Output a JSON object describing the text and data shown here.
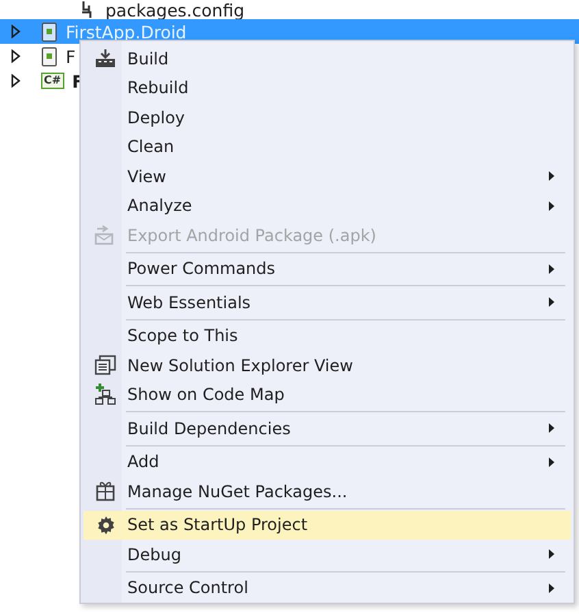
{
  "tree": [
    {
      "label": "packages.config",
      "kind": "file",
      "selected": false,
      "bold": false
    },
    {
      "label": "FirstApp.Droid",
      "kind": "android",
      "selected": true,
      "bold": false
    },
    {
      "label": "F",
      "kind": "ios",
      "selected": false,
      "bold": false
    },
    {
      "label": "F",
      "kind": "csharp",
      "selected": false,
      "bold": true,
      "badge": "C#"
    }
  ],
  "context_menu": [
    {
      "kind": "command",
      "label": "Build",
      "disabled": false,
      "selected": false
    },
    {
      "kind": "command",
      "label": "Rebuild",
      "disabled": false,
      "selected": false
    },
    {
      "kind": "command",
      "label": "Deploy",
      "disabled": false,
      "selected": false
    },
    {
      "kind": "command",
      "label": "Clean",
      "disabled": false,
      "selected": false
    },
    {
      "kind": "submenu",
      "label": "View",
      "disabled": false,
      "selected": false
    },
    {
      "kind": "submenu",
      "label": "Analyze",
      "disabled": false,
      "selected": false
    },
    {
      "kind": "command",
      "label": "Export Android Package (.apk)",
      "disabled": true,
      "selected": false
    },
    {
      "kind": "separator"
    },
    {
      "kind": "submenu",
      "label": "Power Commands",
      "disabled": false,
      "selected": false
    },
    {
      "kind": "separator"
    },
    {
      "kind": "submenu",
      "label": "Web Essentials",
      "disabled": false,
      "selected": false
    },
    {
      "kind": "separator"
    },
    {
      "kind": "command",
      "label": "Scope to This",
      "disabled": false,
      "selected": false
    },
    {
      "kind": "command",
      "label": "New Solution Explorer View",
      "disabled": false,
      "selected": false
    },
    {
      "kind": "command",
      "label": "Show on Code Map",
      "disabled": false,
      "selected": false
    },
    {
      "kind": "separator"
    },
    {
      "kind": "submenu",
      "label": "Build Dependencies",
      "disabled": false,
      "selected": false
    },
    {
      "kind": "separator"
    },
    {
      "kind": "submenu",
      "label": "Add",
      "disabled": false,
      "selected": false
    },
    {
      "kind": "command",
      "label": "Manage NuGet Packages...",
      "disabled": false,
      "selected": false
    },
    {
      "kind": "separator"
    },
    {
      "kind": "command",
      "label": "Set as StartUp Project",
      "disabled": false,
      "selected": true
    },
    {
      "kind": "submenu",
      "label": "Debug",
      "disabled": false,
      "selected": false
    },
    {
      "kind": "separator"
    },
    {
      "kind": "submenu",
      "label": "Source Control",
      "disabled": false,
      "selected": false
    }
  ]
}
